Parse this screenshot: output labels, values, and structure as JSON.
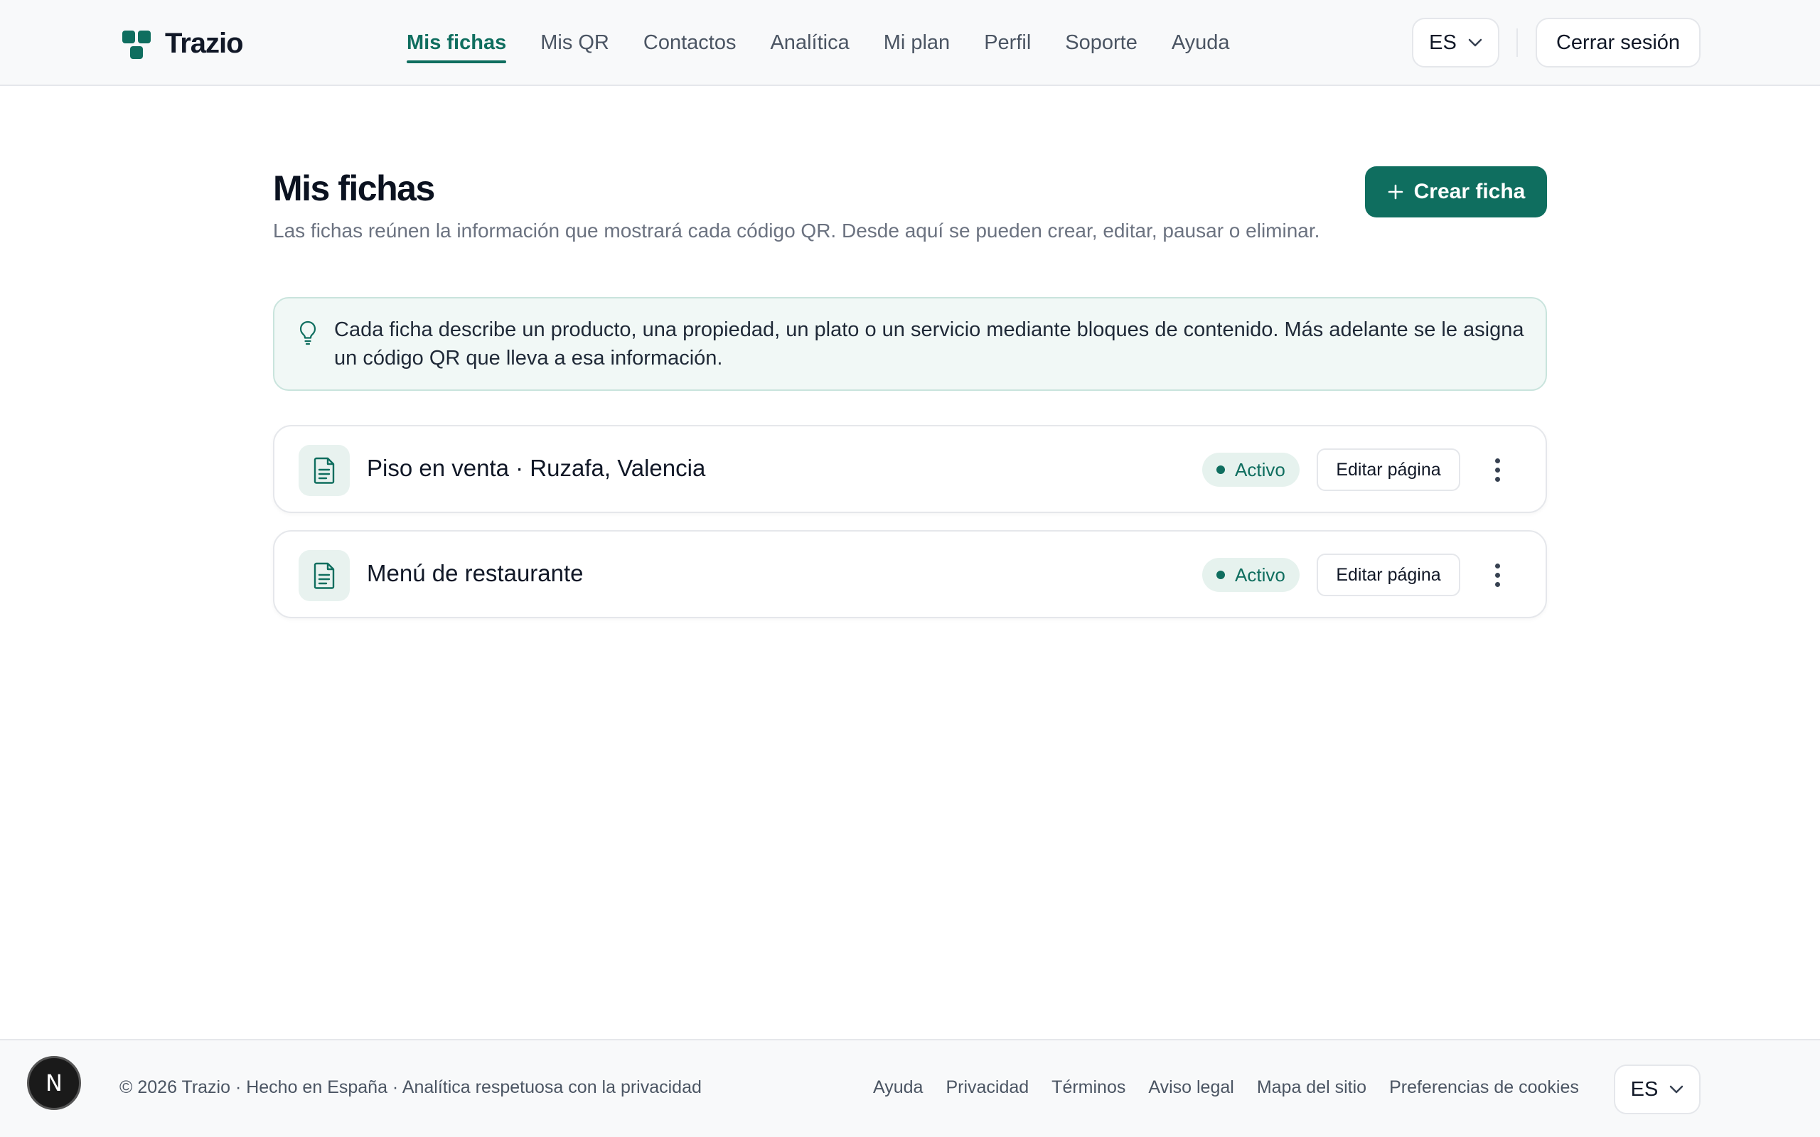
{
  "app": {
    "brand_name": "Trazio",
    "accent_color": "#0f6e5f"
  },
  "nav": {
    "items": [
      {
        "label": "Mis fichas",
        "active": true
      },
      {
        "label": "Mis QR"
      },
      {
        "label": "Contactos"
      },
      {
        "label": "Analítica"
      },
      {
        "label": "Mi plan"
      },
      {
        "label": "Perfil"
      },
      {
        "label": "Soporte"
      },
      {
        "label": "Ayuda"
      }
    ]
  },
  "header": {
    "language": "ES",
    "logout_label": "Cerrar sesión"
  },
  "main": {
    "title": "Mis fichas",
    "description": "Las fichas reúnen la información que mostrará cada código QR. Desde aquí se pueden crear, editar, pausar o eliminar.",
    "create_label": "Crear ficha",
    "info": "Cada ficha describe un producto, una propiedad, un plato o un servicio mediante bloques de contenido. Más adelante se le asigna un código QR que lleva a esa información.",
    "cards": [
      {
        "title": "Piso en venta · Ruzafa, Valencia",
        "status": "Activo",
        "edit_label": "Editar página"
      },
      {
        "title": "Menú de restaurante",
        "status": "Activo",
        "edit_label": "Editar página"
      }
    ]
  },
  "footer": {
    "copyright": "© 2026 Trazio · Hecho en España · Analítica respetuosa con la privacidad",
    "links": [
      "Ayuda",
      "Privacidad",
      "Términos",
      "Aviso legal",
      "Mapa del sitio",
      "Preferencias de cookies"
    ],
    "language": "ES"
  },
  "dev_badge": {
    "letter": "N"
  }
}
